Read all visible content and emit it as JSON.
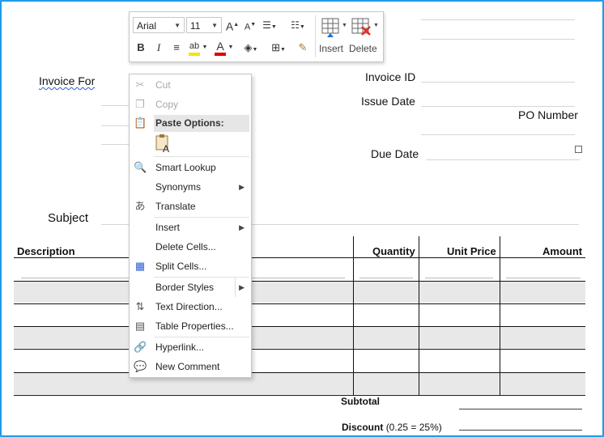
{
  "document": {
    "invoice_for": "Invoice For",
    "invoice_id": "Invoice ID",
    "issue_date": "Issue Date",
    "po_number": "PO Number",
    "due_date": "Due Date",
    "subject": "Subject",
    "columns": [
      "Description",
      "Quantity",
      "Unit Price",
      "Amount"
    ],
    "subtotal": "Subtotal",
    "discount_label": "Discount",
    "discount_note": "(0.25 = 25%)"
  },
  "mini_toolbar": {
    "font_name": "Arial",
    "font_size": "11",
    "insert_label": "Insert",
    "delete_label": "Delete",
    "highlight_color": "#f2e600",
    "font_color": "#e00000"
  },
  "context_menu": {
    "items": [
      {
        "label": "Cut",
        "icon": "scissors-icon",
        "disabled": true
      },
      {
        "label": "Copy",
        "icon": "copy-icon",
        "disabled": true
      },
      {
        "label": "Paste Options:",
        "icon": "clipboard-icon",
        "header": true
      },
      {
        "label": "Smart Lookup",
        "icon": "smart-lookup-icon"
      },
      {
        "label": "Synonyms",
        "submenu": true
      },
      {
        "label": "Translate",
        "icon": "translate-icon"
      },
      {
        "label": "Insert",
        "submenu": true
      },
      {
        "label": "Delete Cells..."
      },
      {
        "label": "Split Cells...",
        "icon": "split-cells-icon"
      },
      {
        "label": "Border Styles",
        "submenu": true
      },
      {
        "label": "Text Direction...",
        "icon": "text-direction-icon"
      },
      {
        "label": "Table Properties...",
        "icon": "table-properties-icon"
      },
      {
        "label": "Hyperlink...",
        "icon": "hyperlink-icon"
      },
      {
        "label": "New Comment",
        "icon": "comment-icon"
      }
    ]
  },
  "colors": {
    "frame_border": "#1e9be9",
    "row_band": "#e8e8e8",
    "menu_highlight": "#e6e6e6"
  }
}
